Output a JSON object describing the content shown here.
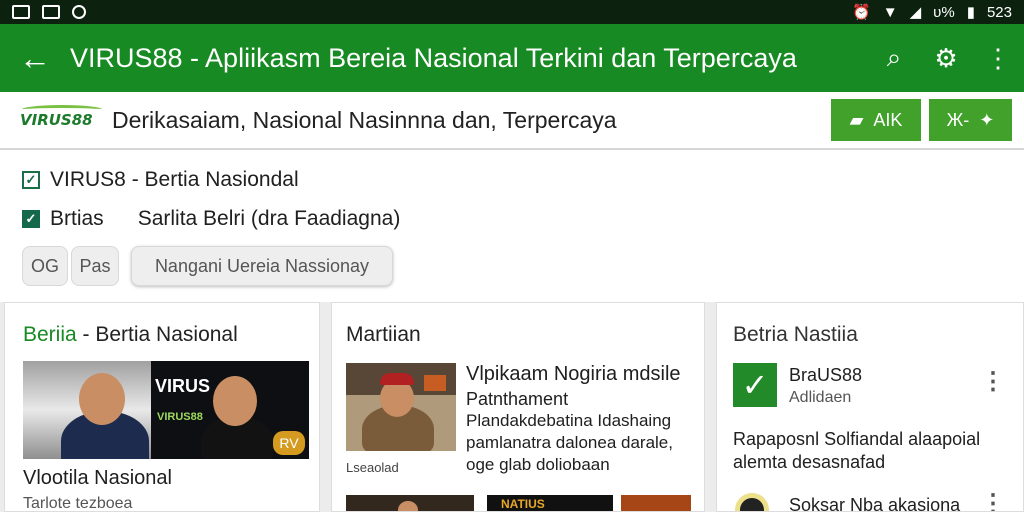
{
  "statusbar": {
    "time": "523",
    "battery": "υ%"
  },
  "appbar": {
    "back_icon": "←",
    "title": "VIRUS88 - Apliikasm Bereia Nasional Terkini dan Terpercaya",
    "search_icon": "⌕",
    "settings_icon": "⚙",
    "more_icon": "⋮"
  },
  "brandbar": {
    "logo_text": "VIRUS88",
    "tagline": "Derikasaiam, Nasional Nasinnna dan, Terpercaya",
    "button_aik": "AIK",
    "button_x": "Ж-"
  },
  "filters": {
    "check1": "VIRUS8 - Bertia Nasiondal",
    "check2": "Brtias",
    "check2_extra": "Sarlita  Belri (dra Faadiagna)",
    "chip1": "OG",
    "chip2": "Pas",
    "chip3": "Nangani Uereia Nassionay"
  },
  "cards": {
    "left": {
      "title_green": "Beriia",
      "title_rest": " - Bertia Nasional",
      "caption": "Vlootila Nasional",
      "subcaption": "Tarlote tezboea",
      "banner_text": "VIRUS",
      "sub_banner": "VIRUS88",
      "badge": "RV"
    },
    "middle": {
      "title": "Martiian",
      "headline": "Vlpikaam Nogiria mdsile",
      "subhead": "Patnthament",
      "body1": "Plandakdebatina Idashaing",
      "body2": "pamlanatra dalonea darale,",
      "body3": "oge glab doliobaan",
      "meta": "Lseaolad",
      "thumb_text": "NATIUS"
    },
    "right": {
      "title": "Betria Nastiia",
      "item1_title": "BraUS88",
      "item1_sub": "Adlidaen",
      "paragraph1": "Rapaposnl Solfiandal alaapoial",
      "paragraph2": "alemta desasnafad",
      "item2_title": "Soksar Nba akasiona"
    }
  }
}
